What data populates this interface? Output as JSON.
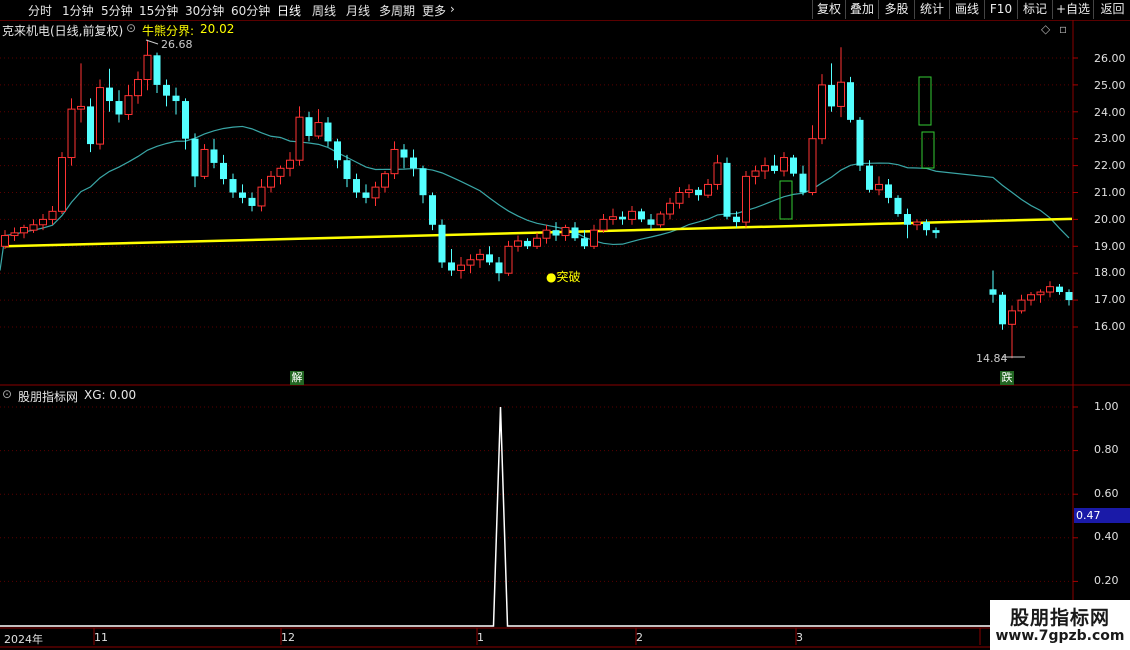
{
  "periods": [
    "分时",
    "1分钟",
    "5分钟",
    "15分钟",
    "30分钟",
    "60分钟",
    "日线",
    "周线",
    "月线",
    "多周期",
    "更多"
  ],
  "active_period": "日线",
  "toolbar_right": [
    "复权",
    "叠加",
    "多股",
    "统计",
    "画线",
    "F10",
    "标记",
    "+自选",
    "返回"
  ],
  "stock": {
    "title": "克来机电(日线,前复权)",
    "indicator_name": "牛熊分界:",
    "indicator_value": "20.02"
  },
  "lower_panel": {
    "name": "股朋指标网",
    "xg_label": "XG: 0.00"
  },
  "annotations": {
    "high": "26.68",
    "low": "14.84",
    "breakout": "突破",
    "badge_jie": "解",
    "badge_die": "跌"
  },
  "price_axis": [
    "26.00",
    "25.00",
    "24.00",
    "23.00",
    "22.00",
    "21.00",
    "20.00",
    "19.00",
    "18.00",
    "17.00",
    "16.00"
  ],
  "lower_axis": [
    "1.00",
    "0.80",
    "0.60",
    "0.40",
    "0.20"
  ],
  "lower_current": "0.47",
  "date_axis": [
    "2024年",
    "11",
    "12",
    "1",
    "2",
    "3"
  ],
  "watermark": {
    "line1": "股朋指标网",
    "line2": "www.7gpzb.com"
  },
  "colors": {
    "up": "#ff3333",
    "down": "#54ffff",
    "ma": "#3aa6a6",
    "bull_bear_line": "#ffff00",
    "signal": "#ffffff",
    "green_candle": "#33cc33",
    "axis_bg_current": "#1a1aa8"
  },
  "chart_data": {
    "type": "candlestick",
    "price_range": [
      14.84,
      26.68
    ],
    "bull_bear_line_start": 19.0,
    "bull_bear_line_end": 20.02,
    "ohlc": [
      [
        19.0,
        19.6,
        18.9,
        19.4
      ],
      [
        19.4,
        19.7,
        19.2,
        19.5
      ],
      [
        19.5,
        19.8,
        19.3,
        19.7
      ],
      [
        19.6,
        20.0,
        19.5,
        19.8
      ],
      [
        19.8,
        20.2,
        19.6,
        20.0
      ],
      [
        20.0,
        20.5,
        19.8,
        20.3
      ],
      [
        20.3,
        22.5,
        20.2,
        22.3
      ],
      [
        22.3,
        24.5,
        22.0,
        24.1
      ],
      [
        24.1,
        25.8,
        23.6,
        24.2
      ],
      [
        24.2,
        24.5,
        22.5,
        22.8
      ],
      [
        22.8,
        25.2,
        22.6,
        24.9
      ],
      [
        24.9,
        25.6,
        24.0,
        24.4
      ],
      [
        24.4,
        24.8,
        23.6,
        23.9
      ],
      [
        23.9,
        25.0,
        23.7,
        24.6
      ],
      [
        24.6,
        25.5,
        24.3,
        25.2
      ],
      [
        25.2,
        26.68,
        24.8,
        26.1
      ],
      [
        26.1,
        26.2,
        24.7,
        25.0
      ],
      [
        25.0,
        25.2,
        24.2,
        24.6
      ],
      [
        24.6,
        24.9,
        23.9,
        24.4
      ],
      [
        24.4,
        24.5,
        22.6,
        23.0
      ],
      [
        23.0,
        23.2,
        21.2,
        21.6
      ],
      [
        21.6,
        22.8,
        21.5,
        22.6
      ],
      [
        22.6,
        23.0,
        21.9,
        22.1
      ],
      [
        22.1,
        22.4,
        21.3,
        21.5
      ],
      [
        21.5,
        21.7,
        20.8,
        21.0
      ],
      [
        21.0,
        21.3,
        20.6,
        20.8
      ],
      [
        20.8,
        21.0,
        20.3,
        20.5
      ],
      [
        20.5,
        21.5,
        20.3,
        21.2
      ],
      [
        21.2,
        21.8,
        21.0,
        21.6
      ],
      [
        21.6,
        22.0,
        21.3,
        21.9
      ],
      [
        21.9,
        22.5,
        21.6,
        22.2
      ],
      [
        22.2,
        24.2,
        22.0,
        23.8
      ],
      [
        23.8,
        24.0,
        22.9,
        23.1
      ],
      [
        23.1,
        24.1,
        23.0,
        23.6
      ],
      [
        23.6,
        23.8,
        22.7,
        22.9
      ],
      [
        22.9,
        23.0,
        21.9,
        22.2
      ],
      [
        22.2,
        22.4,
        21.2,
        21.5
      ],
      [
        21.5,
        21.7,
        20.8,
        21.0
      ],
      [
        21.0,
        21.3,
        20.6,
        20.8
      ],
      [
        20.8,
        21.4,
        20.5,
        21.2
      ],
      [
        21.2,
        21.8,
        21.0,
        21.7
      ],
      [
        21.7,
        22.9,
        21.5,
        22.6
      ],
      [
        22.6,
        22.8,
        21.9,
        22.3
      ],
      [
        22.3,
        22.6,
        21.6,
        21.9
      ],
      [
        21.9,
        22.0,
        20.6,
        20.9
      ],
      [
        20.9,
        21.0,
        19.6,
        19.8
      ],
      [
        19.8,
        20.0,
        18.2,
        18.4
      ],
      [
        18.4,
        18.9,
        17.9,
        18.1
      ],
      [
        18.1,
        18.6,
        17.8,
        18.3
      ],
      [
        18.3,
        18.7,
        18.0,
        18.5
      ],
      [
        18.5,
        18.9,
        18.2,
        18.7
      ],
      [
        18.7,
        19.0,
        18.3,
        18.4
      ],
      [
        18.4,
        18.6,
        17.7,
        18.0
      ],
      [
        18.0,
        19.2,
        17.9,
        19.0
      ],
      [
        19.0,
        19.4,
        18.8,
        19.2
      ],
      [
        19.2,
        19.3,
        18.9,
        19.0
      ],
      [
        19.0,
        19.5,
        18.9,
        19.3
      ],
      [
        19.3,
        19.8,
        19.1,
        19.6
      ],
      [
        19.6,
        19.9,
        19.2,
        19.4
      ],
      [
        19.4,
        19.8,
        19.2,
        19.7
      ],
      [
        19.7,
        19.9,
        19.2,
        19.3
      ],
      [
        19.3,
        19.6,
        18.9,
        19.0
      ],
      [
        19.0,
        19.8,
        18.9,
        19.6
      ],
      [
        19.6,
        20.2,
        19.5,
        20.0
      ],
      [
        20.0,
        20.4,
        19.8,
        20.1
      ],
      [
        20.1,
        20.3,
        19.8,
        20.0
      ],
      [
        20.0,
        20.5,
        19.8,
        20.3
      ],
      [
        20.3,
        20.4,
        19.9,
        20.0
      ],
      [
        20.0,
        20.2,
        19.6,
        19.8
      ],
      [
        19.8,
        20.3,
        19.7,
        20.2
      ],
      [
        20.2,
        20.8,
        20.0,
        20.6
      ],
      [
        20.6,
        21.2,
        20.4,
        21.0
      ],
      [
        21.0,
        21.3,
        20.8,
        21.1
      ],
      [
        21.1,
        21.2,
        20.7,
        20.9
      ],
      [
        20.9,
        21.5,
        20.8,
        21.3
      ],
      [
        21.3,
        22.4,
        21.1,
        22.1
      ],
      [
        22.1,
        22.3,
        20.0,
        20.1
      ],
      [
        20.1,
        20.3,
        19.7,
        19.9
      ],
      [
        19.9,
        21.8,
        19.7,
        21.6
      ],
      [
        21.6,
        22.0,
        21.3,
        21.8
      ],
      [
        21.8,
        22.3,
        21.5,
        22.0
      ],
      [
        22.0,
        22.4,
        21.7,
        21.8
      ],
      [
        21.8,
        22.5,
        21.6,
        22.3
      ],
      [
        22.3,
        22.4,
        21.6,
        21.7
      ],
      [
        21.7,
        22.0,
        20.9,
        21.0
      ],
      [
        21.0,
        23.5,
        20.9,
        23.0
      ],
      [
        23.0,
        25.4,
        22.8,
        25.0
      ],
      [
        25.0,
        25.8,
        24.0,
        24.2
      ],
      [
        24.2,
        26.4,
        23.8,
        25.1
      ],
      [
        25.1,
        25.3,
        23.6,
        23.7
      ],
      [
        23.7,
        23.8,
        21.8,
        22.0
      ],
      [
        22.0,
        22.2,
        21.0,
        21.1
      ],
      [
        21.1,
        21.6,
        20.9,
        21.3
      ],
      [
        21.3,
        21.5,
        20.6,
        20.8
      ],
      [
        20.8,
        20.9,
        20.1,
        20.2
      ],
      [
        20.2,
        20.4,
        19.3,
        19.8
      ],
      [
        19.8,
        20.0,
        19.6,
        19.9
      ],
      [
        19.9,
        20.0,
        19.4,
        19.6
      ],
      [
        19.6,
        19.7,
        19.3,
        19.5
      ],
      [
        17.4,
        18.1,
        16.9,
        17.2
      ],
      [
        17.2,
        17.3,
        15.9,
        16.1
      ],
      [
        16.1,
        16.8,
        14.84,
        16.6
      ],
      [
        16.6,
        17.2,
        16.5,
        17.0
      ],
      [
        17.0,
        17.3,
        16.8,
        17.2
      ],
      [
        17.2,
        17.4,
        16.9,
        17.3
      ],
      [
        17.3,
        17.7,
        17.1,
        17.5
      ],
      [
        17.5,
        17.6,
        17.2,
        17.3
      ],
      [
        17.3,
        17.4,
        16.8,
        17.0
      ]
    ],
    "signal_index": 53,
    "signal_value": 1.0
  }
}
